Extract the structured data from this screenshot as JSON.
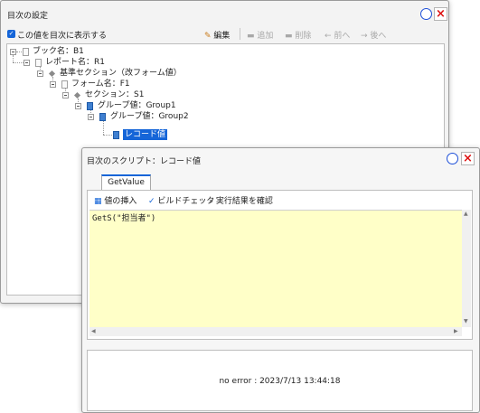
{
  "window1": {
    "title": "目次の設定",
    "show_in_toc_label": "この値を目次に表示する",
    "toolbar": {
      "edit": "編集",
      "add": "追加",
      "delete": "削除",
      "prev": "前へ",
      "next": "後へ"
    },
    "tree": [
      "ブック名：B1",
      "レポート名：R1",
      "基準セクション（改フォーム値）",
      "フォーム名：F1",
      "セクション：S1",
      "グループ値：Group1",
      "グループ値：Group2",
      "レコード値"
    ]
  },
  "window2": {
    "title": "目次のスクリプト：レコード値",
    "tab": "GetValue",
    "toolbar": {
      "insert_value": "値の挿入",
      "build_check": "ビルドチェック",
      "check_result": "実行結果を確認"
    },
    "script": "GetS(\"担当者\")",
    "status": "no error : 2023/7/13 13:44:18"
  },
  "colors": {
    "accent": "#1565d8",
    "editor_bg": "#ffffc8",
    "close": "#dd1111"
  }
}
